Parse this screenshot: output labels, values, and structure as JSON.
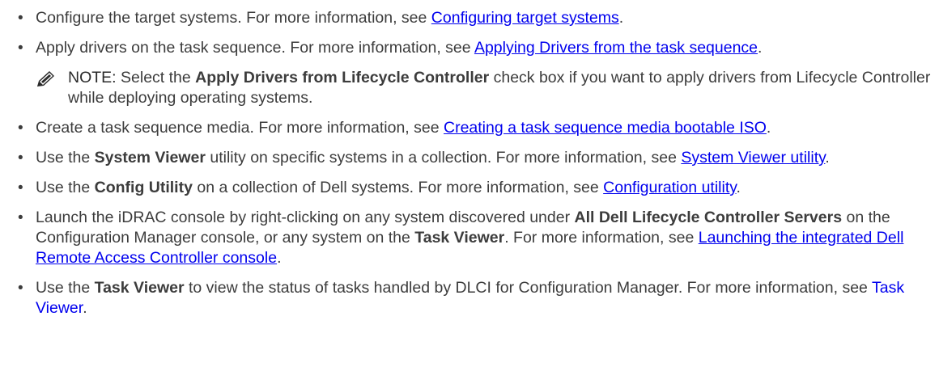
{
  "bullets": [
    {
      "pre": "Configure the target systems. For more information, see ",
      "link": "Configuring target systems",
      "post": "."
    },
    {
      "pre": "Apply drivers on the task sequence. For more information, see ",
      "link": "Applying Drivers from the task sequence",
      "post": "."
    },
    {
      "pre": "Create a task sequence media. For more information, see ",
      "link": "Creating a task sequence media bootable ISO",
      "post": "."
    },
    {
      "pre": "Use the ",
      "bold": "System Viewer",
      "mid": " utility on specific systems in a collection. For more information, see ",
      "link": "System Viewer utility",
      "post": "."
    },
    {
      "pre": "Use the ",
      "bold": "Config Utility",
      "mid": " on a collection of Dell systems. For more information, see ",
      "link": "Configuration utility",
      "post": "."
    },
    {
      "pre": "Launch the iDRAC console by right-clicking on any system discovered under ",
      "bold": "All Dell Lifecycle Controller Servers",
      "mid": " on the Configuration Manager console, or any system on the ",
      "bold2": "Task Viewer",
      "mid2": ". For more information, see ",
      "link": "Launching the integrated Dell Remote Access Controller console",
      "post": "."
    },
    {
      "pre": "Use the ",
      "bold": "Task Viewer",
      "mid": " to view the status of tasks handled by DLCI for Configuration Manager. For more information, see ",
      "link": "Task Viewer",
      "post": "."
    }
  ],
  "note": {
    "label": "NOTE:",
    "pre": " Select the ",
    "bold": "Apply Drivers from Lifecycle Controller",
    "post": " check box if you want to apply drivers from Lifecycle Controller while deploying operating systems."
  },
  "colors": {
    "link": "#0000ee",
    "text": "#3c3c3c"
  },
  "icons": {
    "note": "pencil-icon",
    "bullet": "bullet"
  }
}
